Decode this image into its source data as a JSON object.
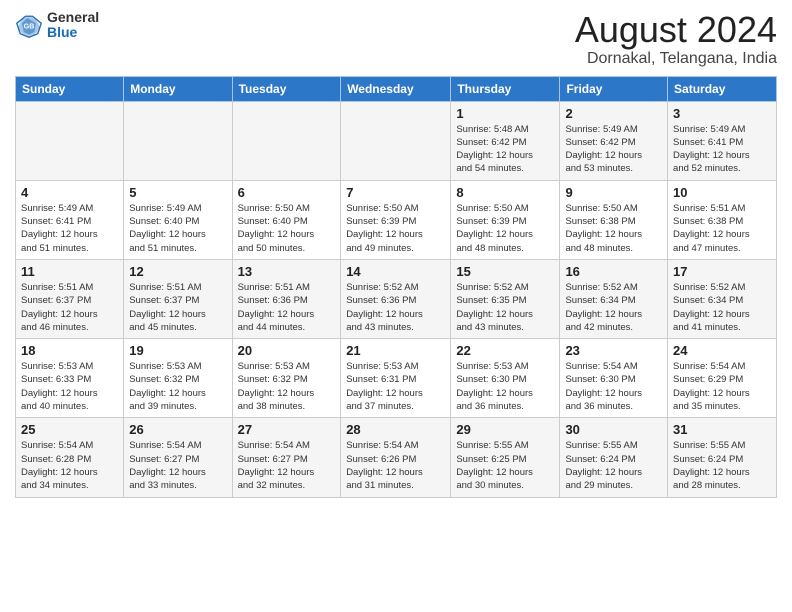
{
  "header": {
    "logo_general": "General",
    "logo_blue": "Blue",
    "title": "August 2024",
    "subtitle": "Dornakal, Telangana, India"
  },
  "days_of_week": [
    "Sunday",
    "Monday",
    "Tuesday",
    "Wednesday",
    "Thursday",
    "Friday",
    "Saturday"
  ],
  "weeks": [
    [
      {
        "day": "",
        "info": ""
      },
      {
        "day": "",
        "info": ""
      },
      {
        "day": "",
        "info": ""
      },
      {
        "day": "",
        "info": ""
      },
      {
        "day": "1",
        "info": "Sunrise: 5:48 AM\nSunset: 6:42 PM\nDaylight: 12 hours\nand 54 minutes."
      },
      {
        "day": "2",
        "info": "Sunrise: 5:49 AM\nSunset: 6:42 PM\nDaylight: 12 hours\nand 53 minutes."
      },
      {
        "day": "3",
        "info": "Sunrise: 5:49 AM\nSunset: 6:41 PM\nDaylight: 12 hours\nand 52 minutes."
      }
    ],
    [
      {
        "day": "4",
        "info": "Sunrise: 5:49 AM\nSunset: 6:41 PM\nDaylight: 12 hours\nand 51 minutes."
      },
      {
        "day": "5",
        "info": "Sunrise: 5:49 AM\nSunset: 6:40 PM\nDaylight: 12 hours\nand 51 minutes."
      },
      {
        "day": "6",
        "info": "Sunrise: 5:50 AM\nSunset: 6:40 PM\nDaylight: 12 hours\nand 50 minutes."
      },
      {
        "day": "7",
        "info": "Sunrise: 5:50 AM\nSunset: 6:39 PM\nDaylight: 12 hours\nand 49 minutes."
      },
      {
        "day": "8",
        "info": "Sunrise: 5:50 AM\nSunset: 6:39 PM\nDaylight: 12 hours\nand 48 minutes."
      },
      {
        "day": "9",
        "info": "Sunrise: 5:50 AM\nSunset: 6:38 PM\nDaylight: 12 hours\nand 48 minutes."
      },
      {
        "day": "10",
        "info": "Sunrise: 5:51 AM\nSunset: 6:38 PM\nDaylight: 12 hours\nand 47 minutes."
      }
    ],
    [
      {
        "day": "11",
        "info": "Sunrise: 5:51 AM\nSunset: 6:37 PM\nDaylight: 12 hours\nand 46 minutes."
      },
      {
        "day": "12",
        "info": "Sunrise: 5:51 AM\nSunset: 6:37 PM\nDaylight: 12 hours\nand 45 minutes."
      },
      {
        "day": "13",
        "info": "Sunrise: 5:51 AM\nSunset: 6:36 PM\nDaylight: 12 hours\nand 44 minutes."
      },
      {
        "day": "14",
        "info": "Sunrise: 5:52 AM\nSunset: 6:36 PM\nDaylight: 12 hours\nand 43 minutes."
      },
      {
        "day": "15",
        "info": "Sunrise: 5:52 AM\nSunset: 6:35 PM\nDaylight: 12 hours\nand 43 minutes."
      },
      {
        "day": "16",
        "info": "Sunrise: 5:52 AM\nSunset: 6:34 PM\nDaylight: 12 hours\nand 42 minutes."
      },
      {
        "day": "17",
        "info": "Sunrise: 5:52 AM\nSunset: 6:34 PM\nDaylight: 12 hours\nand 41 minutes."
      }
    ],
    [
      {
        "day": "18",
        "info": "Sunrise: 5:53 AM\nSunset: 6:33 PM\nDaylight: 12 hours\nand 40 minutes."
      },
      {
        "day": "19",
        "info": "Sunrise: 5:53 AM\nSunset: 6:32 PM\nDaylight: 12 hours\nand 39 minutes."
      },
      {
        "day": "20",
        "info": "Sunrise: 5:53 AM\nSunset: 6:32 PM\nDaylight: 12 hours\nand 38 minutes."
      },
      {
        "day": "21",
        "info": "Sunrise: 5:53 AM\nSunset: 6:31 PM\nDaylight: 12 hours\nand 37 minutes."
      },
      {
        "day": "22",
        "info": "Sunrise: 5:53 AM\nSunset: 6:30 PM\nDaylight: 12 hours\nand 36 minutes."
      },
      {
        "day": "23",
        "info": "Sunrise: 5:54 AM\nSunset: 6:30 PM\nDaylight: 12 hours\nand 36 minutes."
      },
      {
        "day": "24",
        "info": "Sunrise: 5:54 AM\nSunset: 6:29 PM\nDaylight: 12 hours\nand 35 minutes."
      }
    ],
    [
      {
        "day": "25",
        "info": "Sunrise: 5:54 AM\nSunset: 6:28 PM\nDaylight: 12 hours\nand 34 minutes."
      },
      {
        "day": "26",
        "info": "Sunrise: 5:54 AM\nSunset: 6:27 PM\nDaylight: 12 hours\nand 33 minutes."
      },
      {
        "day": "27",
        "info": "Sunrise: 5:54 AM\nSunset: 6:27 PM\nDaylight: 12 hours\nand 32 minutes."
      },
      {
        "day": "28",
        "info": "Sunrise: 5:54 AM\nSunset: 6:26 PM\nDaylight: 12 hours\nand 31 minutes."
      },
      {
        "day": "29",
        "info": "Sunrise: 5:55 AM\nSunset: 6:25 PM\nDaylight: 12 hours\nand 30 minutes."
      },
      {
        "day": "30",
        "info": "Sunrise: 5:55 AM\nSunset: 6:24 PM\nDaylight: 12 hours\nand 29 minutes."
      },
      {
        "day": "31",
        "info": "Sunrise: 5:55 AM\nSunset: 6:24 PM\nDaylight: 12 hours\nand 28 minutes."
      }
    ]
  ]
}
